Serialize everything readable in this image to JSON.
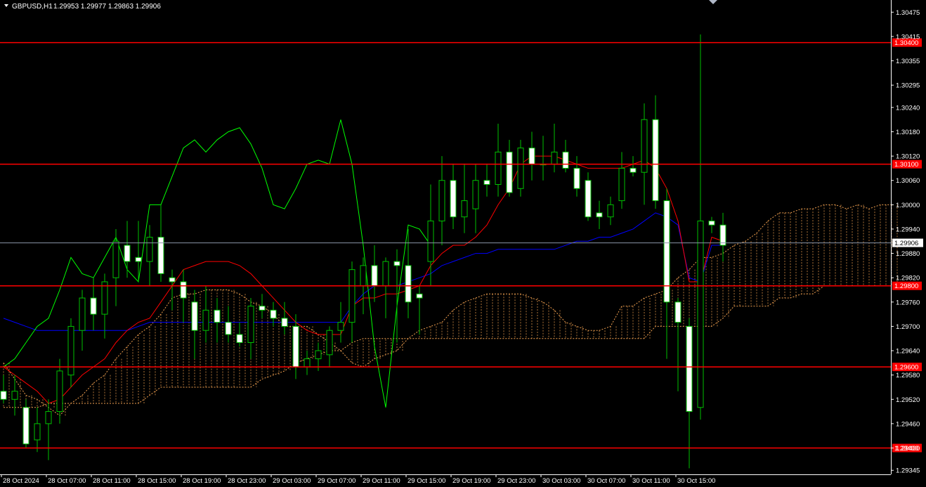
{
  "header": {
    "symbol": "GBPUSD,H1",
    "ohlc": "1.29953 1.29977 1.29863 1.29906"
  },
  "colors": {
    "background": "#000000",
    "candle_fill_up": "#000000",
    "candle_fill_down": "#ffffff",
    "candle_wick": "#00c000",
    "tenkan": "#ff0000",
    "kijun": "#0000ff",
    "chikou": "#00ff00",
    "senkou": "#f0a050",
    "level_line": "#ff0000",
    "current_price_line": "#8a94a6",
    "axis_text": "#ffffff"
  },
  "chart_data": {
    "type": "candlestick",
    "symbol": "GBPUSD",
    "timeframe": "H1",
    "ylim": [
      1.29335,
      1.30505
    ],
    "y_ticks": [
      "1.30475",
      "1.30415",
      "1.30355",
      "1.30295",
      "1.30240",
      "1.30180",
      "1.30120",
      "1.30060",
      "1.30000",
      "1.29940",
      "1.29880",
      "1.29820",
      "1.29760",
      "1.29700",
      "1.29640",
      "1.29580",
      "1.29520",
      "1.29460",
      "1.29400",
      "1.29345"
    ],
    "x_ticks": [
      "28 Oct 2024",
      "28 Oct 07:00",
      "28 Oct 11:00",
      "28 Oct 15:00",
      "28 Oct 19:00",
      "28 Oct 23:00",
      "29 Oct 03:00",
      "29 Oct 07:00",
      "29 Oct 11:00",
      "29 Oct 15:00",
      "29 Oct 19:00",
      "29 Oct 23:00",
      "30 Oct 03:00",
      "30 Oct 07:00",
      "30 Oct 11:00",
      "30 Oct 15:00"
    ],
    "candles": [
      [
        1.2954,
        1.2958,
        1.2951,
        1.2952
      ],
      [
        1.2952,
        1.2958,
        1.2948,
        1.2954
      ],
      [
        1.295,
        1.2952,
        1.294,
        1.2941
      ],
      [
        1.2942,
        1.295,
        1.2939,
        1.2946
      ],
      [
        1.2946,
        1.2952,
        1.2937,
        1.2949
      ],
      [
        1.2949,
        1.2962,
        1.2946,
        1.2959
      ],
      [
        1.2958,
        1.2972,
        1.2955,
        1.297
      ],
      [
        1.2969,
        1.2979,
        1.2964,
        1.2977
      ],
      [
        1.2977,
        1.2982,
        1.2969,
        1.2973
      ],
      [
        1.2973,
        1.2983,
        1.2967,
        1.2981
      ],
      [
        1.2982,
        1.2994,
        1.2975,
        1.2991
      ],
      [
        1.299,
        1.2996,
        1.2982,
        1.2986
      ],
      [
        1.2987,
        1.2996,
        1.2981,
        1.2986
      ],
      [
        1.2986,
        1.2995,
        1.298,
        1.2992
      ],
      [
        1.2992,
        1.3,
        1.2981,
        1.2983
      ],
      [
        1.2982,
        1.2984,
        1.2974,
        1.2981
      ],
      [
        1.2981,
        1.2984,
        1.2971,
        1.2977
      ],
      [
        1.2976,
        1.2979,
        1.2962,
        1.2969
      ],
      [
        1.2969,
        1.298,
        1.2966,
        1.2974
      ],
      [
        1.2974,
        1.2977,
        1.2966,
        1.2971
      ],
      [
        1.2971,
        1.2975,
        1.2966,
        1.2968
      ],
      [
        1.2968,
        1.2971,
        1.2965,
        1.2966
      ],
      [
        1.2966,
        1.2977,
        1.2962,
        1.2975
      ],
      [
        1.2975,
        1.2978,
        1.2972,
        1.2974
      ],
      [
        1.2974,
        1.2976,
        1.297,
        1.2972
      ],
      [
        1.2972,
        1.2976,
        1.2968,
        1.297
      ],
      [
        1.297,
        1.2973,
        1.2957,
        1.296
      ],
      [
        1.296,
        1.2964,
        1.2958,
        1.2962
      ],
      [
        1.2962,
        1.2966,
        1.2959,
        1.2964
      ],
      [
        1.2963,
        1.297,
        1.296,
        1.2969
      ],
      [
        1.2969,
        1.2976,
        1.2966,
        1.2971
      ],
      [
        1.2971,
        1.2986,
        1.2966,
        1.2984
      ],
      [
        1.298,
        1.2987,
        1.2973,
        1.2985
      ],
      [
        1.2985,
        1.299,
        1.2976,
        1.298
      ],
      [
        1.298,
        1.2987,
        1.2972,
        1.2986
      ],
      [
        1.2986,
        1.2989,
        1.2966,
        1.2985
      ],
      [
        1.2985,
        1.2994,
        1.2972,
        1.2976
      ],
      [
        1.2978,
        1.298,
        1.2968,
        1.2977
      ],
      [
        1.2986,
        1.3005,
        1.298,
        1.2996
      ],
      [
        1.2996,
        1.3012,
        1.299,
        1.3006
      ],
      [
        1.3006,
        1.301,
        1.2994,
        1.2997
      ],
      [
        1.2997,
        1.301,
        1.2993,
        1.3001
      ],
      [
        1.2999,
        1.301,
        1.2993,
        1.3006
      ],
      [
        1.3006,
        1.301,
        1.3002,
        1.3005
      ],
      [
        1.3005,
        1.302,
        1.3002,
        1.3013
      ],
      [
        1.3013,
        1.3016,
        1.3002,
        1.3003
      ],
      [
        1.3004,
        1.3016,
        1.3002,
        1.3014
      ],
      [
        1.3014,
        1.3018,
        1.3006,
        1.301
      ],
      [
        1.301,
        1.3017,
        1.3006,
        1.301
      ],
      [
        1.301,
        1.302,
        1.3008,
        1.3013
      ],
      [
        1.3013,
        1.3016,
        1.3008,
        1.3009
      ],
      [
        1.3009,
        1.3012,
        1.3002,
        1.3004
      ],
      [
        1.3006,
        1.3008,
        1.2996,
        1.2997
      ],
      [
        1.2998,
        1.3001,
        1.2994,
        1.2997
      ],
      [
        1.2997,
        1.3002,
        1.2995,
        1.3
      ],
      [
        1.3001,
        1.3013,
        1.2999,
        1.3009
      ],
      [
        1.3009,
        1.3012,
        1.3007,
        1.3008
      ],
      [
        1.3008,
        1.3025,
        1.3,
        1.3021
      ],
      [
        1.3021,
        1.3027,
        1.2999,
        1.3001
      ],
      [
        1.3001,
        1.3004,
        1.2962,
        1.2976
      ],
      [
        1.2976,
        1.2977,
        1.2954,
        1.2971
      ],
      [
        1.297,
        1.2972,
        1.2935,
        1.2949
      ],
      [
        1.295,
        1.3042,
        1.2947,
        1.2996
      ],
      [
        1.2996,
        1.2997,
        1.2993,
        1.2995
      ],
      [
        1.2995,
        1.2998,
        1.2986,
        1.299
      ]
    ],
    "indicators": {
      "tenkan_sen": [
        1.296,
        1.2958,
        1.2956,
        1.2954,
        1.2951,
        1.2952,
        1.2955,
        1.2958,
        1.296,
        1.2962,
        1.2966,
        1.2969,
        1.2971,
        1.2972,
        1.2976,
        1.298,
        1.2984,
        1.2985,
        1.2986,
        1.2986,
        1.2986,
        1.2985,
        1.2983,
        1.298,
        1.2977,
        1.2974,
        1.2971,
        1.2969,
        1.2968,
        1.2968,
        1.2968,
        1.2975,
        1.2977,
        1.2977,
        1.2978,
        1.2978,
        1.2979,
        1.298,
        1.2985,
        1.2988,
        1.299,
        1.299,
        1.2992,
        1.2995,
        1.3,
        1.3004,
        1.301,
        1.3012,
        1.3012,
        1.3012,
        1.3011,
        1.301,
        1.3009,
        1.3009,
        1.3009,
        1.3009,
        1.301,
        1.3011,
        1.3009,
        1.3004,
        1.2996,
        1.2981,
        1.2981,
        1.2992,
        1.2991
      ],
      "kijun_sen": [
        1.2972,
        1.2971,
        1.297,
        1.2969,
        1.2969,
        1.2969,
        1.2969,
        1.2969,
        1.2969,
        1.2969,
        1.2969,
        1.2969,
        1.297,
        1.2971,
        1.2971,
        1.2971,
        1.2971,
        1.2971,
        1.2971,
        1.2971,
        1.2971,
        1.2971,
        1.2971,
        1.2971,
        1.2971,
        1.2971,
        1.2971,
        1.2971,
        1.2971,
        1.2971,
        1.2971,
        1.2975,
        1.2978,
        1.298,
        1.298,
        1.298,
        1.2981,
        1.2982,
        1.2983,
        1.2985,
        1.2986,
        1.2987,
        1.2988,
        1.2988,
        1.2989,
        1.2989,
        1.2989,
        1.2989,
        1.2989,
        1.2989,
        1.299,
        1.2991,
        1.2991,
        1.2992,
        1.2992,
        1.2993,
        1.2994,
        1.2996,
        1.2998,
        1.2997,
        1.2995,
        1.2982,
        1.2981,
        1.299,
        1.299
      ],
      "chikou_span": [
        1.296,
        1.2962,
        1.2966,
        1.297,
        1.2972,
        1.2979,
        1.2987,
        1.2983,
        1.2982,
        1.2987,
        1.2992,
        1.2984,
        1.2981,
        1.3,
        1.3,
        1.3007,
        1.3014,
        1.3016,
        1.3013,
        1.3016,
        1.3018,
        1.3019,
        1.3015,
        1.3009,
        1.3,
        1.2999,
        1.3004,
        1.301,
        1.3011,
        1.301,
        1.3021,
        1.301,
        1.299,
        1.2965,
        1.295,
        1.2975,
        1.2995,
        1.2994,
        1.299
      ],
      "senkou_a": [
        1.2961,
        1.2957,
        1.2953,
        1.2952,
        1.295,
        1.2948,
        1.2951,
        1.2953,
        1.2956,
        1.2958,
        1.2962,
        1.2965,
        1.2968,
        1.297,
        1.2973,
        1.2977,
        1.2978,
        1.2978,
        1.2979,
        1.2979,
        1.2979,
        1.2978,
        1.2976,
        1.2975,
        1.2973,
        1.297,
        1.297,
        1.297,
        1.2968,
        1.2966,
        1.2964,
        1.2961,
        1.296,
        1.2962,
        1.2963,
        1.2964,
        1.2967,
        1.2969,
        1.297,
        1.2971,
        1.2974,
        1.2976,
        1.2977,
        1.2978,
        1.2978,
        1.2978,
        1.2978,
        1.2977,
        1.2976,
        1.2974,
        1.2971,
        1.297,
        1.2969,
        1.2969,
        1.297,
        1.2975,
        1.2975,
        1.2977,
        1.2978,
        1.2979,
        1.2982,
        1.2984,
        1.2987,
        1.2987,
        1.2988,
        1.299,
        1.2991,
        1.2993,
        1.2996,
        1.2998,
        1.2998,
        1.2999,
        1.2999,
        1.3,
        1.3,
        1.2999,
        1.3,
        1.2999,
        1.3,
        1.3
      ],
      "senkou_b": [
        1.295,
        1.295,
        1.295,
        1.295,
        1.2951,
        1.2951,
        1.2951,
        1.2951,
        1.2951,
        1.2951,
        1.2951,
        1.2951,
        1.2951,
        1.2953,
        1.2955,
        1.2955,
        1.2955,
        1.2955,
        1.2955,
        1.2955,
        1.2955,
        1.2955,
        1.2955,
        1.2957,
        1.2958,
        1.2959,
        1.2961,
        1.2962,
        1.2963,
        1.2964,
        1.2964,
        1.2966,
        1.2967,
        1.2967,
        1.2967,
        1.2967,
        1.2967,
        1.2967,
        1.2967,
        1.2967,
        1.2967,
        1.2967,
        1.2967,
        1.2967,
        1.2967,
        1.2967,
        1.2967,
        1.2967,
        1.2967,
        1.2967,
        1.2967,
        1.2967,
        1.2967,
        1.2967,
        1.2967,
        1.2967,
        1.2967,
        1.2967,
        1.297,
        1.297,
        1.297,
        1.297,
        1.297,
        1.297,
        1.2972,
        1.2975,
        1.2975,
        1.2975,
        1.2975,
        1.2977,
        1.2977,
        1.2978,
        1.2978,
        1.298,
        1.298,
        1.298,
        1.298,
        1.298,
        1.298,
        1.298
      ]
    },
    "horizontal_levels": [
      {
        "price": 1.304,
        "label": "1.30400"
      },
      {
        "price": 1.301,
        "label": "1.30100"
      },
      {
        "price": 1.298,
        "label": "1.29800"
      },
      {
        "price": 1.296,
        "label": "1.29600"
      },
      {
        "price": 1.294,
        "label": "1.29400"
      }
    ],
    "current_price": {
      "price": 1.29906,
      "label": "1.29906"
    }
  }
}
